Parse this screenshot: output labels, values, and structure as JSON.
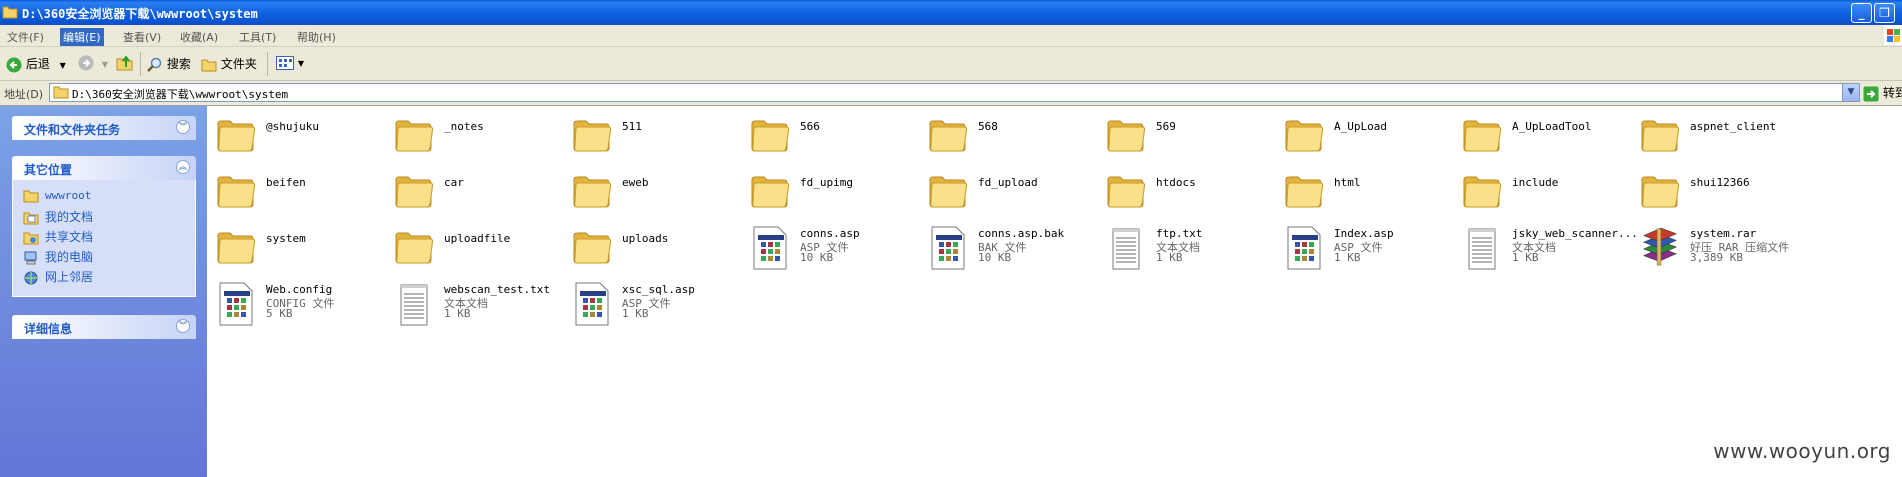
{
  "window": {
    "title": "D:\\360安全浏览器下载\\wwwroot\\system"
  },
  "menu": {
    "file": "文件(F)",
    "edit": "编辑(E)",
    "view": "查看(V)",
    "favorites": "收藏(A)",
    "tools": "工具(T)",
    "help": "帮助(H)"
  },
  "toolbar": {
    "back": "后退",
    "search": "搜索",
    "folders": "文件夹"
  },
  "address": {
    "label": "地址(D)",
    "path": "D:\\360安全浏览器下载\\wwwroot\\system",
    "go": "转到"
  },
  "taskpane": {
    "tasks_title": "文件和文件夹任务",
    "other_title": "其它位置",
    "details_title": "详细信息",
    "places": [
      {
        "label": "wwwroot",
        "icon": "folder-icon"
      },
      {
        "label": "我的文档",
        "icon": "my-documents-icon"
      },
      {
        "label": "共享文档",
        "icon": "shared-documents-icon"
      },
      {
        "label": "我的电脑",
        "icon": "my-computer-icon"
      },
      {
        "label": "网上邻居",
        "icon": "network-places-icon"
      }
    ]
  },
  "items": [
    {
      "name": "@shujuku",
      "kind": "folder"
    },
    {
      "name": "_notes",
      "kind": "folder"
    },
    {
      "name": "511",
      "kind": "folder"
    },
    {
      "name": "566",
      "kind": "folder"
    },
    {
      "name": "568",
      "kind": "folder"
    },
    {
      "name": "569",
      "kind": "folder"
    },
    {
      "name": "A_UpLoad",
      "kind": "folder"
    },
    {
      "name": "A_UpLoadTool",
      "kind": "folder"
    },
    {
      "name": "aspnet_client",
      "kind": "folder"
    },
    {
      "name": "beifen",
      "kind": "folder"
    },
    {
      "name": "car",
      "kind": "folder"
    },
    {
      "name": "eweb",
      "kind": "folder"
    },
    {
      "name": "fd_upimg",
      "kind": "folder"
    },
    {
      "name": "fd_upload",
      "kind": "folder"
    },
    {
      "name": "htdocs",
      "kind": "folder"
    },
    {
      "name": "html",
      "kind": "folder"
    },
    {
      "name": "include",
      "kind": "folder"
    },
    {
      "name": "shui12366",
      "kind": "folder"
    },
    {
      "name": "system",
      "kind": "folder"
    },
    {
      "name": "uploadfile",
      "kind": "folder"
    },
    {
      "name": "uploads",
      "kind": "folder"
    },
    {
      "name": "conns.asp",
      "kind": "asp",
      "type": "ASP 文件",
      "size": "10 KB"
    },
    {
      "name": "conns.asp.bak",
      "kind": "asp",
      "type": "BAK 文件",
      "size": "10 KB"
    },
    {
      "name": "ftp.txt",
      "kind": "txt",
      "type": "文本文档",
      "size": "1 KB"
    },
    {
      "name": "Index.asp",
      "kind": "asp",
      "type": "ASP 文件",
      "size": "1 KB"
    },
    {
      "name": "jsky_web_scanner...",
      "kind": "txt",
      "type": "文本文档",
      "size": "1 KB"
    },
    {
      "name": "system.rar",
      "kind": "rar",
      "type": "好压 RAR 压缩文件",
      "size": "3,389 KB"
    },
    {
      "name": "Web.config",
      "kind": "asp",
      "type": "CONFIG 文件",
      "size": "5 KB"
    },
    {
      "name": "webscan_test.txt",
      "kind": "txt",
      "type": "文本文档",
      "size": "1 KB"
    },
    {
      "name": "xsc_sql.asp",
      "kind": "asp",
      "type": "ASP 文件",
      "size": "1 KB"
    }
  ],
  "watermark": "www.wooyun.org"
}
